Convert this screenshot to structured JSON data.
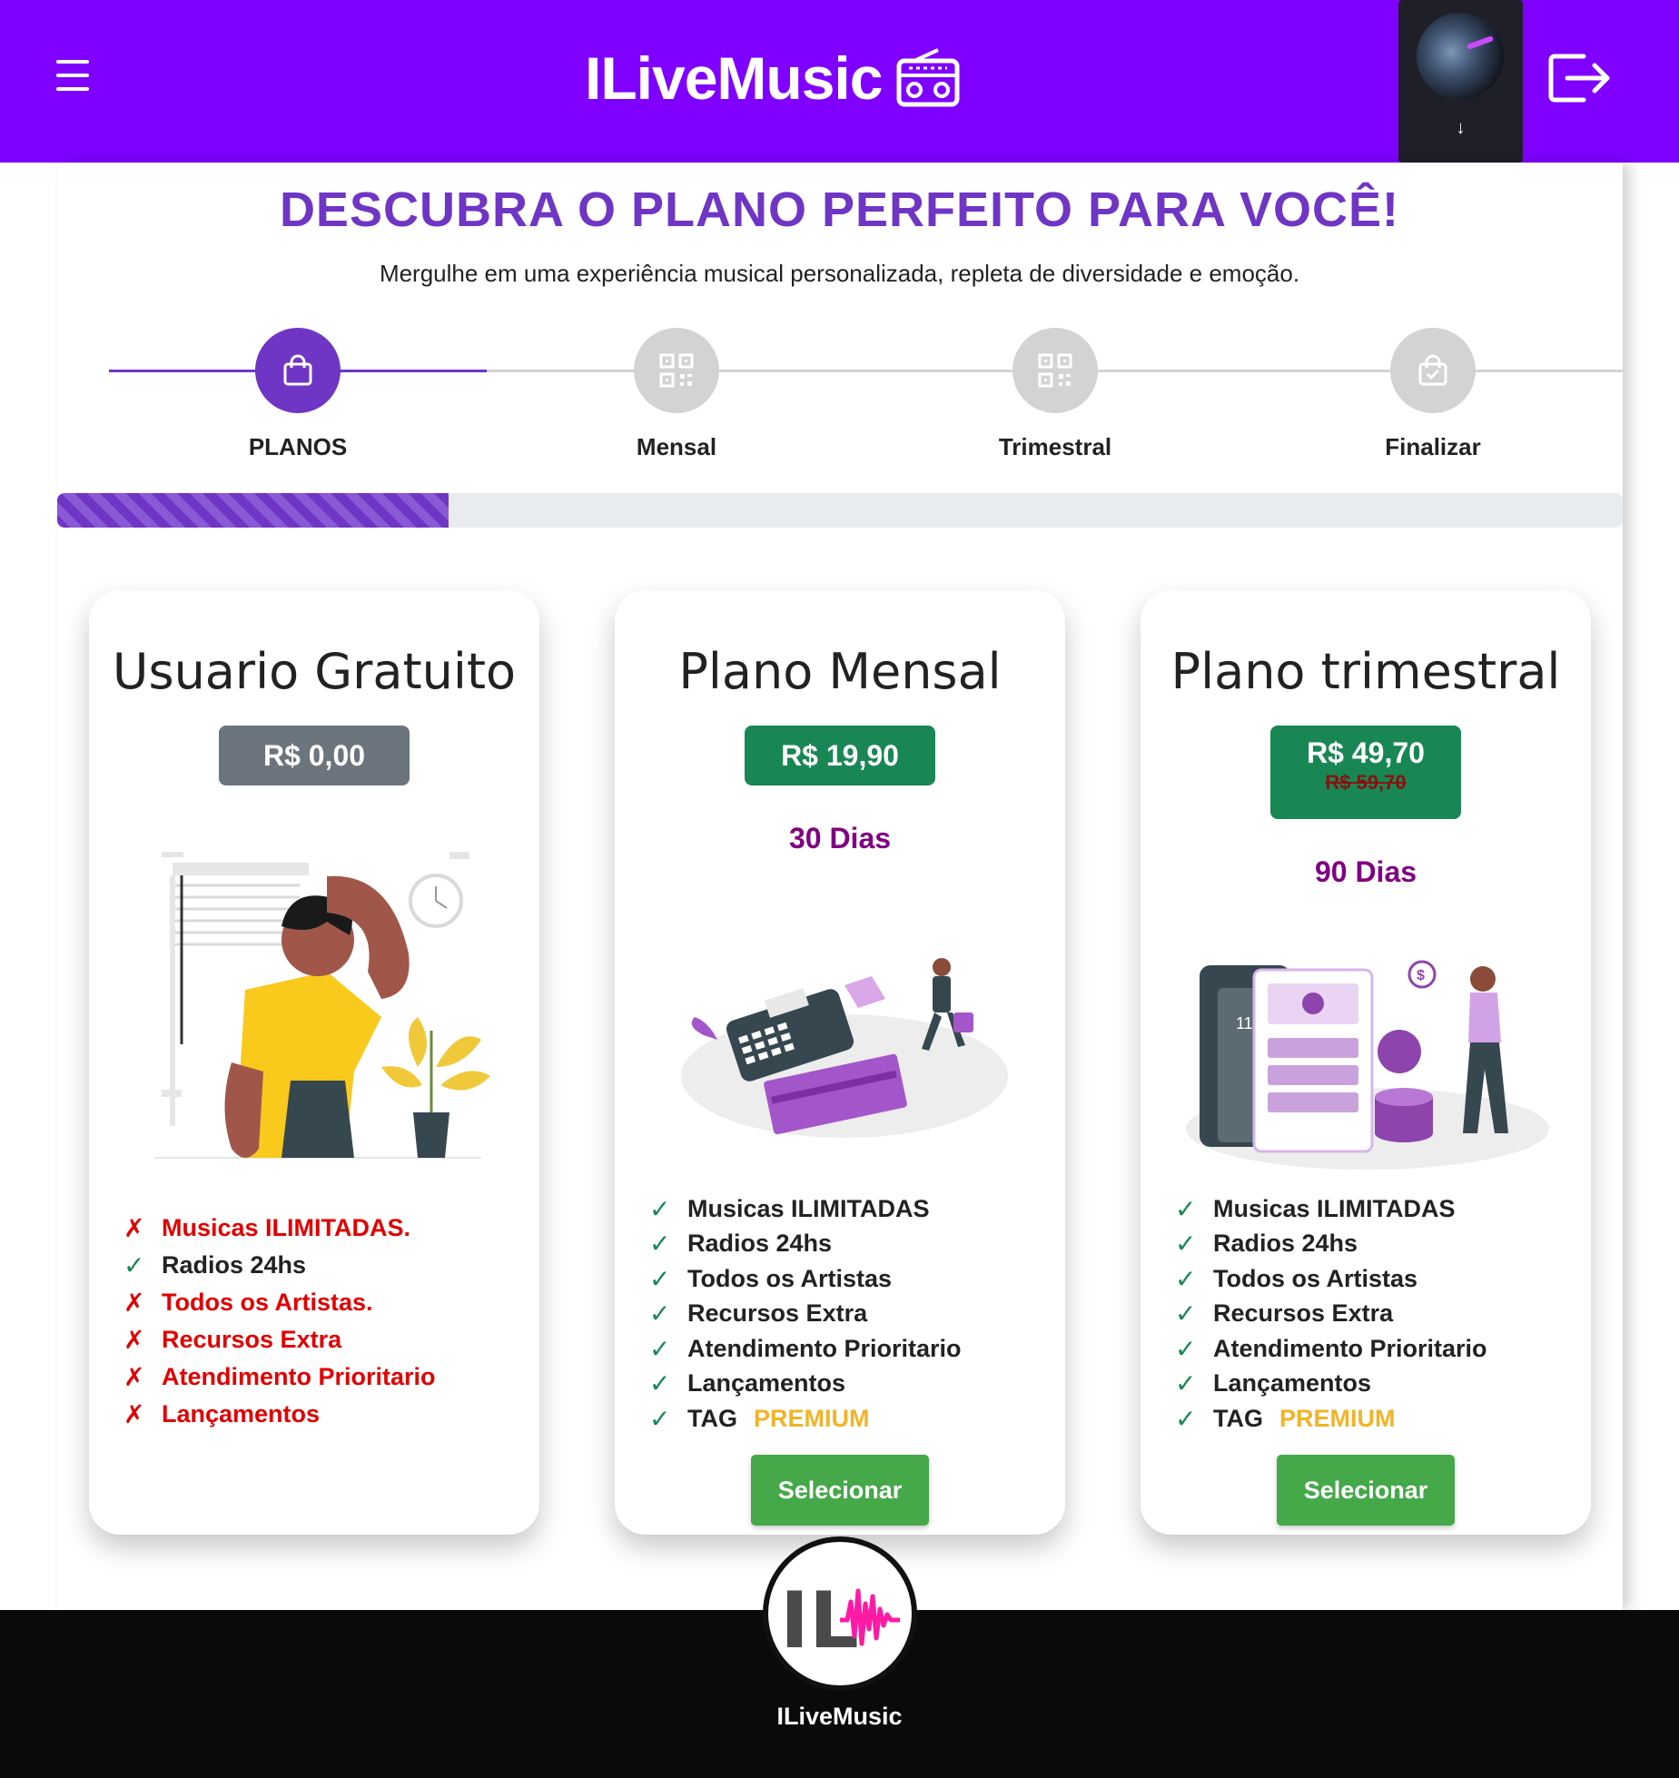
{
  "header": {
    "brand": "ILiveMusic",
    "menu_icon": "hamburger-icon",
    "brand_icon": "radio-icon",
    "avatar_arrow": "↓",
    "logout_icon": "logout-icon",
    "colors": {
      "bar": "#7f00ff"
    }
  },
  "hero": {
    "title": "DESCUBRA O PLANO PERFEITO PARA VOCÊ!",
    "subtitle": "Mergulhe em uma experiência musical personalizada, repleta de diversidade e emoção."
  },
  "stepper": {
    "steps": [
      {
        "label": "PLANOS",
        "icon": "shopping-bag-icon",
        "active": true
      },
      {
        "label": "Mensal",
        "icon": "qr-code-icon",
        "active": false
      },
      {
        "label": "Trimestral",
        "icon": "qr-code-icon",
        "active": false
      },
      {
        "label": "Finalizar",
        "icon": "bag-check-icon",
        "active": false
      }
    ],
    "progress_fraction": 0.25,
    "colors": {
      "active": "#6f35c5",
      "inactive": "#d3d3d3"
    }
  },
  "plans": [
    {
      "title": "Usuario Gratuito",
      "price": "R$ 0,00",
      "illustration": "confused-person-illustration",
      "features": [
        {
          "mark": "✗",
          "text": "Musicas ILIMITADAS.",
          "included": false
        },
        {
          "mark": "✓",
          "text": "Radios 24hs",
          "included": true
        },
        {
          "mark": "✗",
          "text": "Todos os Artistas.",
          "included": false
        },
        {
          "mark": "✗",
          "text": "Recursos Extra",
          "included": false
        },
        {
          "mark": "✗",
          "text": "Atendimento Prioritario",
          "included": false
        },
        {
          "mark": "✗",
          "text": "Lançamentos",
          "included": false
        }
      ]
    },
    {
      "title": "Plano Mensal",
      "price": "R$ 19,90",
      "days": "30 Dias",
      "illustration": "card-payment-illustration",
      "features": [
        {
          "mark": "✓",
          "text": "Musicas ILIMITADAS"
        },
        {
          "mark": "✓",
          "text": "Radios 24hs"
        },
        {
          "mark": "✓",
          "text": "Todos os Artistas"
        },
        {
          "mark": "✓",
          "text": "Recursos Extra"
        },
        {
          "mark": "✓",
          "text": "Atendimento Prioritario"
        },
        {
          "mark": "✓",
          "text": "Lançamentos"
        },
        {
          "mark": "✓",
          "text": "TAG",
          "tag": "PREMIUM"
        }
      ],
      "button": "Selecionar"
    },
    {
      "title": "Plano trimestral",
      "price": "R$ 49,70",
      "old_price": "R$ 59,70",
      "days": "90 Dias",
      "illustration": "mobile-payment-illustration",
      "features": [
        {
          "mark": "✓",
          "text": "Musicas ILIMITADAS"
        },
        {
          "mark": "✓",
          "text": "Radios 24hs"
        },
        {
          "mark": "✓",
          "text": "Todos os Artistas"
        },
        {
          "mark": "✓",
          "text": "Recursos Extra"
        },
        {
          "mark": "✓",
          "text": "Atendimento Prioritario"
        },
        {
          "mark": "✓",
          "text": "Lançamentos"
        },
        {
          "mark": "✓",
          "text": "TAG",
          "tag": "PREMIUM"
        }
      ],
      "button": "Selecionar"
    }
  ],
  "footer": {
    "logo_text": "IL",
    "name": "ILiveMusic"
  },
  "colors": {
    "title": "#6f35c5",
    "price_free": "#6c757d",
    "price_paid": "#198754",
    "days": "#800080",
    "check": "#198754",
    "cross": "#e00000",
    "premium": "#f0b429",
    "button": "#45a849"
  }
}
